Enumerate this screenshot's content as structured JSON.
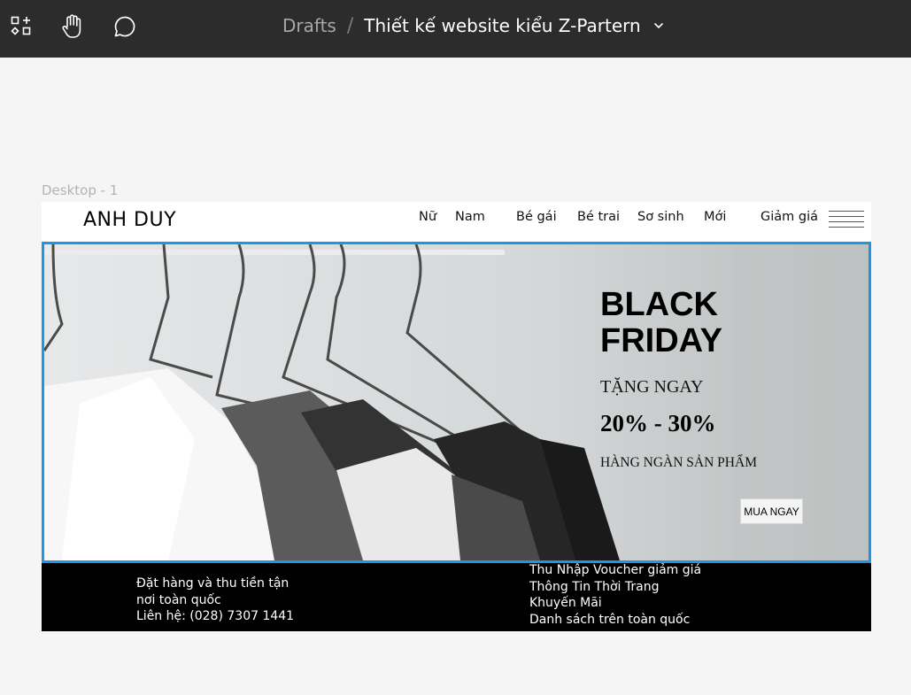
{
  "toolbar": {
    "icons": [
      "assets-icon",
      "hand-tool-icon",
      "comment-icon"
    ],
    "breadcrumb_root": "Drafts",
    "breadcrumb_separator": "/",
    "file_name": "Thiết kế website kiểu Z-Partern"
  },
  "canvas": {
    "frame_label": "Desktop - 1"
  },
  "site": {
    "logo": "ANH DUY",
    "nav": [
      "Nữ",
      "Nam",
      "Bé gái",
      "Bé trai",
      "Sơ sinh",
      "Mới",
      "Giảm giá"
    ],
    "hero": {
      "title_line1": "BLACK",
      "title_line2": "FRIDAY",
      "offer_label": "TẶNG NGAY",
      "discount": "20% - 30%",
      "subtitle": "HÀNG NGÀN SẢN PHẨM",
      "cta": "MUA NGAY"
    },
    "footer": {
      "left": [
        "Đặt hàng và thu tiền tận",
        "nơi toàn quốc",
        "Liên hệ: (028) 7307 1441"
      ],
      "right": [
        "Thu Nhập Voucher giảm giá",
        "Thông Tin Thời Trang",
        "Khuyến Mãi",
        "Danh sách trên toàn quốc"
      ]
    }
  },
  "colors": {
    "toolbar_bg": "#2c2c2c",
    "canvas_bg": "#f5f5f5",
    "selection": "#1e96e8",
    "footer_bg": "#000000"
  }
}
